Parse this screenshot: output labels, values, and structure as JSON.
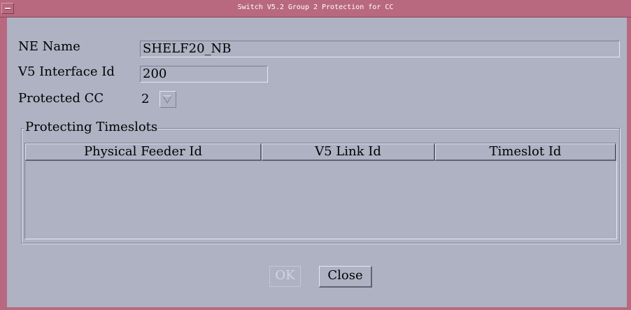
{
  "window": {
    "title": "Switch V5.2 Group 2 Protection for CC"
  },
  "form": {
    "ne_name_label": "NE Name",
    "ne_name_value": "SHELF20_NB",
    "v5_interface_label": "V5 Interface Id",
    "v5_interface_value": "200",
    "protected_cc_label": "Protected CC",
    "protected_cc_value": "2"
  },
  "protecting_timeslots": {
    "title": "Protecting Timeslots",
    "columns": [
      "Physical Feeder Id",
      "V5 Link Id",
      "Timeslot Id"
    ],
    "rows": []
  },
  "buttons": {
    "ok_label": "OK",
    "ok_enabled": false,
    "close_label": "Close"
  },
  "colors": {
    "frame": "#b9697f",
    "background": "#aeb2c3"
  }
}
